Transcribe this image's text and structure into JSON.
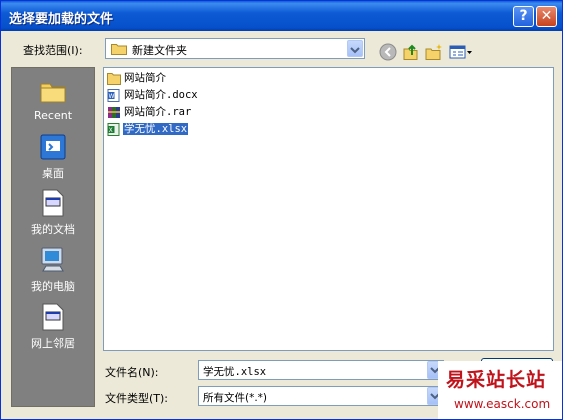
{
  "dialog": {
    "title": "选择要加载的文件",
    "help_glyph": "?",
    "close_glyph": "✕"
  },
  "lookin": {
    "label": "查找范围(I):",
    "value": "新建文件夹"
  },
  "places": [
    {
      "label": "Recent",
      "icon": "recent-folder-icon"
    },
    {
      "label": "桌面",
      "icon": "desktop-icon"
    },
    {
      "label": "我的文档",
      "icon": "my-documents-icon"
    },
    {
      "label": "我的电脑",
      "icon": "my-computer-icon"
    },
    {
      "label": "网上邻居",
      "icon": "network-places-icon"
    }
  ],
  "files": [
    {
      "name": "网站简介",
      "icon": "folder-icon",
      "selected": false
    },
    {
      "name": "网站简介.docx",
      "icon": "word-document-icon",
      "selected": false
    },
    {
      "name": "网站简介.rar",
      "icon": "rar-archive-icon",
      "selected": false
    },
    {
      "name": "学无忧.xlsx",
      "icon": "excel-document-icon",
      "selected": true
    }
  ],
  "filename": {
    "label": "文件名(N):",
    "value": "学无忧.xlsx"
  },
  "filetype": {
    "label": "文件类型(T):",
    "value": "所有文件(*.*)"
  },
  "watermark": {
    "text": "易采站长站",
    "url": "www.easck.com"
  },
  "colors": {
    "title_bar": "#0a5fd8",
    "selection": "#316ac5",
    "places_bar": "#808080",
    "watermark": "#c0131b"
  }
}
